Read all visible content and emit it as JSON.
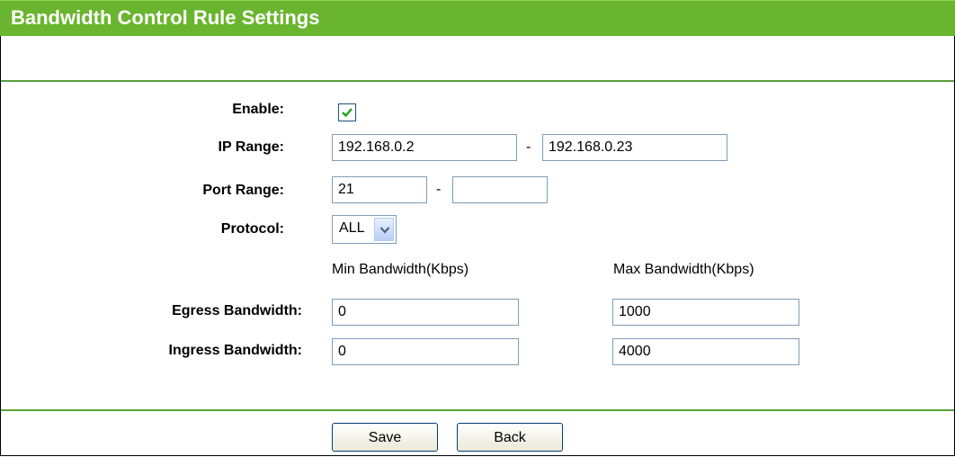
{
  "header": {
    "title": "Bandwidth Control Rule Settings"
  },
  "form": {
    "enable_label": "Enable:",
    "enable_checked": true,
    "ip_range_label": "IP Range:",
    "ip_start": "192.168.0.2",
    "ip_end": "192.168.0.23",
    "range_separator": "-",
    "port_range_label": "Port Range:",
    "port_start": "21",
    "port_end": "",
    "protocol_label": "Protocol:",
    "protocol_value": "ALL",
    "min_bandwidth_header": "Min Bandwidth(Kbps)",
    "max_bandwidth_header": "Max Bandwidth(Kbps)",
    "egress_label": "Egress Bandwidth:",
    "egress_min": "0",
    "egress_max": "1000",
    "ingress_label": "Ingress Bandwidth:",
    "ingress_min": "0",
    "ingress_max": "4000"
  },
  "buttons": {
    "save": "Save",
    "back": "Back"
  },
  "colors": {
    "header_green": "#6ab52f",
    "rule_green": "#5aa03a"
  }
}
